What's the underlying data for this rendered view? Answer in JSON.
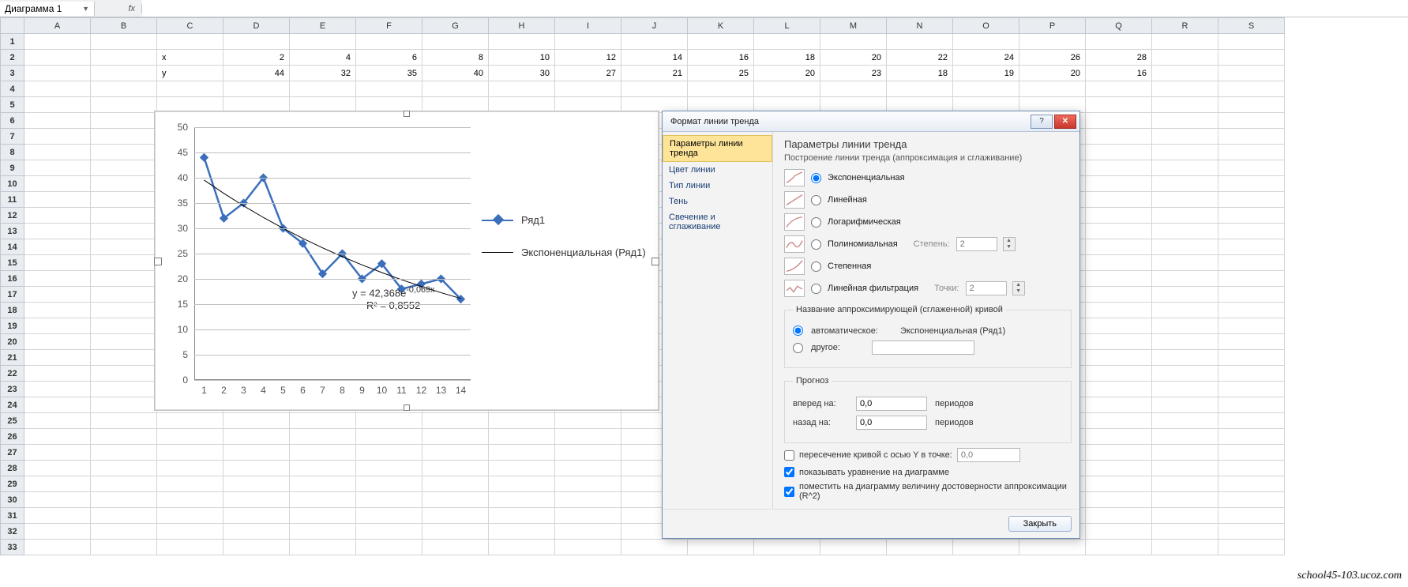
{
  "namebox": "Диаграмма 1",
  "fx": "fx",
  "formula": "",
  "columns": [
    "A",
    "B",
    "C",
    "D",
    "E",
    "F",
    "G",
    "H",
    "I",
    "J",
    "K",
    "L",
    "M",
    "N",
    "O",
    "P",
    "Q",
    "R",
    "S"
  ],
  "row_labels": {
    "x": "x",
    "y": "y"
  },
  "data_x": [
    2,
    4,
    6,
    8,
    10,
    12,
    14,
    16,
    18,
    20,
    22,
    24,
    26,
    28
  ],
  "data_y": [
    44,
    32,
    35,
    40,
    30,
    27,
    21,
    25,
    20,
    23,
    18,
    19,
    20,
    16
  ],
  "chart_data": {
    "type": "line",
    "categories": [
      1,
      2,
      3,
      4,
      5,
      6,
      7,
      8,
      9,
      10,
      11,
      12,
      13,
      14
    ],
    "series": [
      {
        "name": "Ряд1",
        "values": [
          44,
          32,
          35,
          40,
          30,
          27,
          21,
          25,
          20,
          23,
          18,
          19,
          20,
          16
        ]
      }
    ],
    "trendline": {
      "type": "exponential",
      "label": "Экспоненциальная (Ряд1)",
      "equation": "y = 42,368e^-0,069x",
      "r2": "R² = 0,8552"
    },
    "ylabel": "",
    "xlabel": "",
    "ylim": [
      0,
      50
    ],
    "ystep": 5,
    "xlim": [
      1,
      14
    ],
    "xstep": 1
  },
  "legend": {
    "series": "Ряд1",
    "trend": "Экспоненциальная (Ряд1)"
  },
  "equation_line1": "y = 42,368e",
  "equation_exp": "-0,069x",
  "equation_line2": "R² = 0,8552",
  "dialog": {
    "title": "Формат линии тренда",
    "nav": {
      "params": "Параметры линии тренда",
      "line_color": "Цвет линии",
      "line_type": "Тип линии",
      "shadow": "Тень",
      "glow": "Свечение и сглаживание"
    },
    "header": "Параметры линии тренда",
    "subheader": "Построение линии тренда (аппроксимация и сглаживание)",
    "opts": {
      "exp": "Экспоненциальная",
      "lin": "Линейная",
      "log": "Логарифмическая",
      "poly": "Полиномиальная",
      "pow": "Степенная",
      "movavg": "Линейная фильтрация"
    },
    "degree_label": "Степень:",
    "degree_val": "2",
    "points_label": "Точки:",
    "points_val": "2",
    "name_group": "Название аппроксимирующей (сглаженной) кривой",
    "name_auto": "автоматическое:",
    "name_auto_value": "Экспоненциальная (Ряд1)",
    "name_other": "другое:",
    "forecast_group": "Прогноз",
    "fwd_label": "вперед на:",
    "fwd_val": "0,0",
    "back_label": "назад на:",
    "back_val": "0,0",
    "periods": "периодов",
    "intercept": "пересечение кривой с осью Y в точке:",
    "intercept_val": "0,0",
    "show_eq": "показывать уравнение на диаграмме",
    "show_r2": "поместить на диаграмму величину достоверности аппроксимации (R^2)",
    "close": "Закрыть"
  },
  "watermark": "school45-103.ucoz.com"
}
